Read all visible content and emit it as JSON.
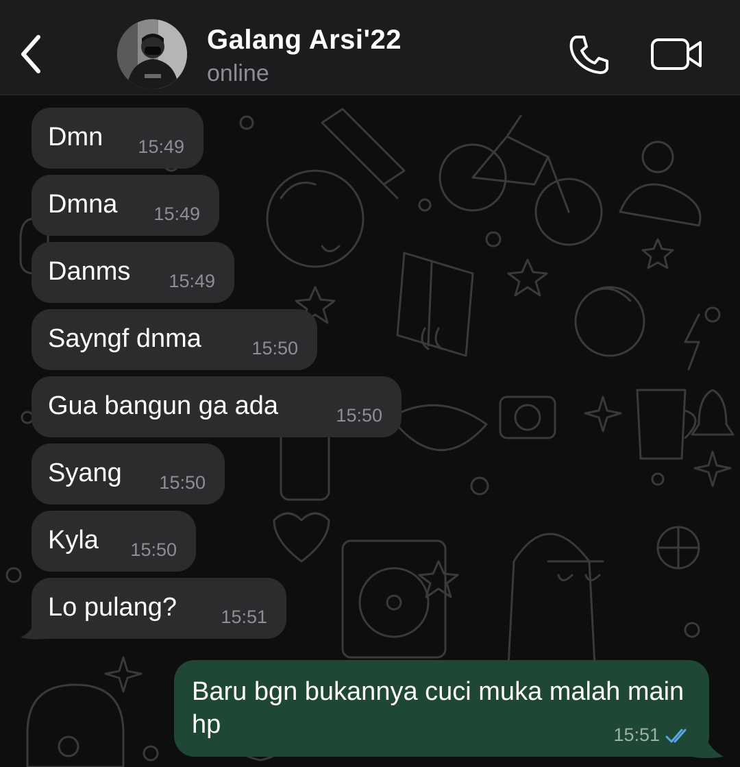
{
  "header": {
    "contact_name": "Galang Arsi'22",
    "status": "online",
    "back_icon": "chevron-left-icon",
    "call_icon": "phone-icon",
    "video_icon": "video-camera-icon"
  },
  "messages_in": [
    {
      "text": "Dmn",
      "time": "15:49"
    },
    {
      "text": "Dmna",
      "time": "15:49"
    },
    {
      "text": "Danms",
      "time": "15:49"
    },
    {
      "text": "Sayngf dnma",
      "time": "15:50"
    },
    {
      "text": "Gua bangun ga ada",
      "time": "15:50"
    },
    {
      "text": "Syang",
      "time": "15:50"
    },
    {
      "text": "Kyla",
      "time": "15:50"
    },
    {
      "text": "Lo pulang?",
      "time": "15:51"
    }
  ],
  "message_out": {
    "text": "Baru bgn bukannya cuci muka malah main hp",
    "time": "15:51",
    "status_icon": "double-check-read-icon"
  },
  "colors": {
    "header_bg": "#1c1c1e",
    "incoming_bubble": "#2c2c2e",
    "outgoing_bubble": "#1f4735",
    "read_tick": "#5aa6e6"
  }
}
